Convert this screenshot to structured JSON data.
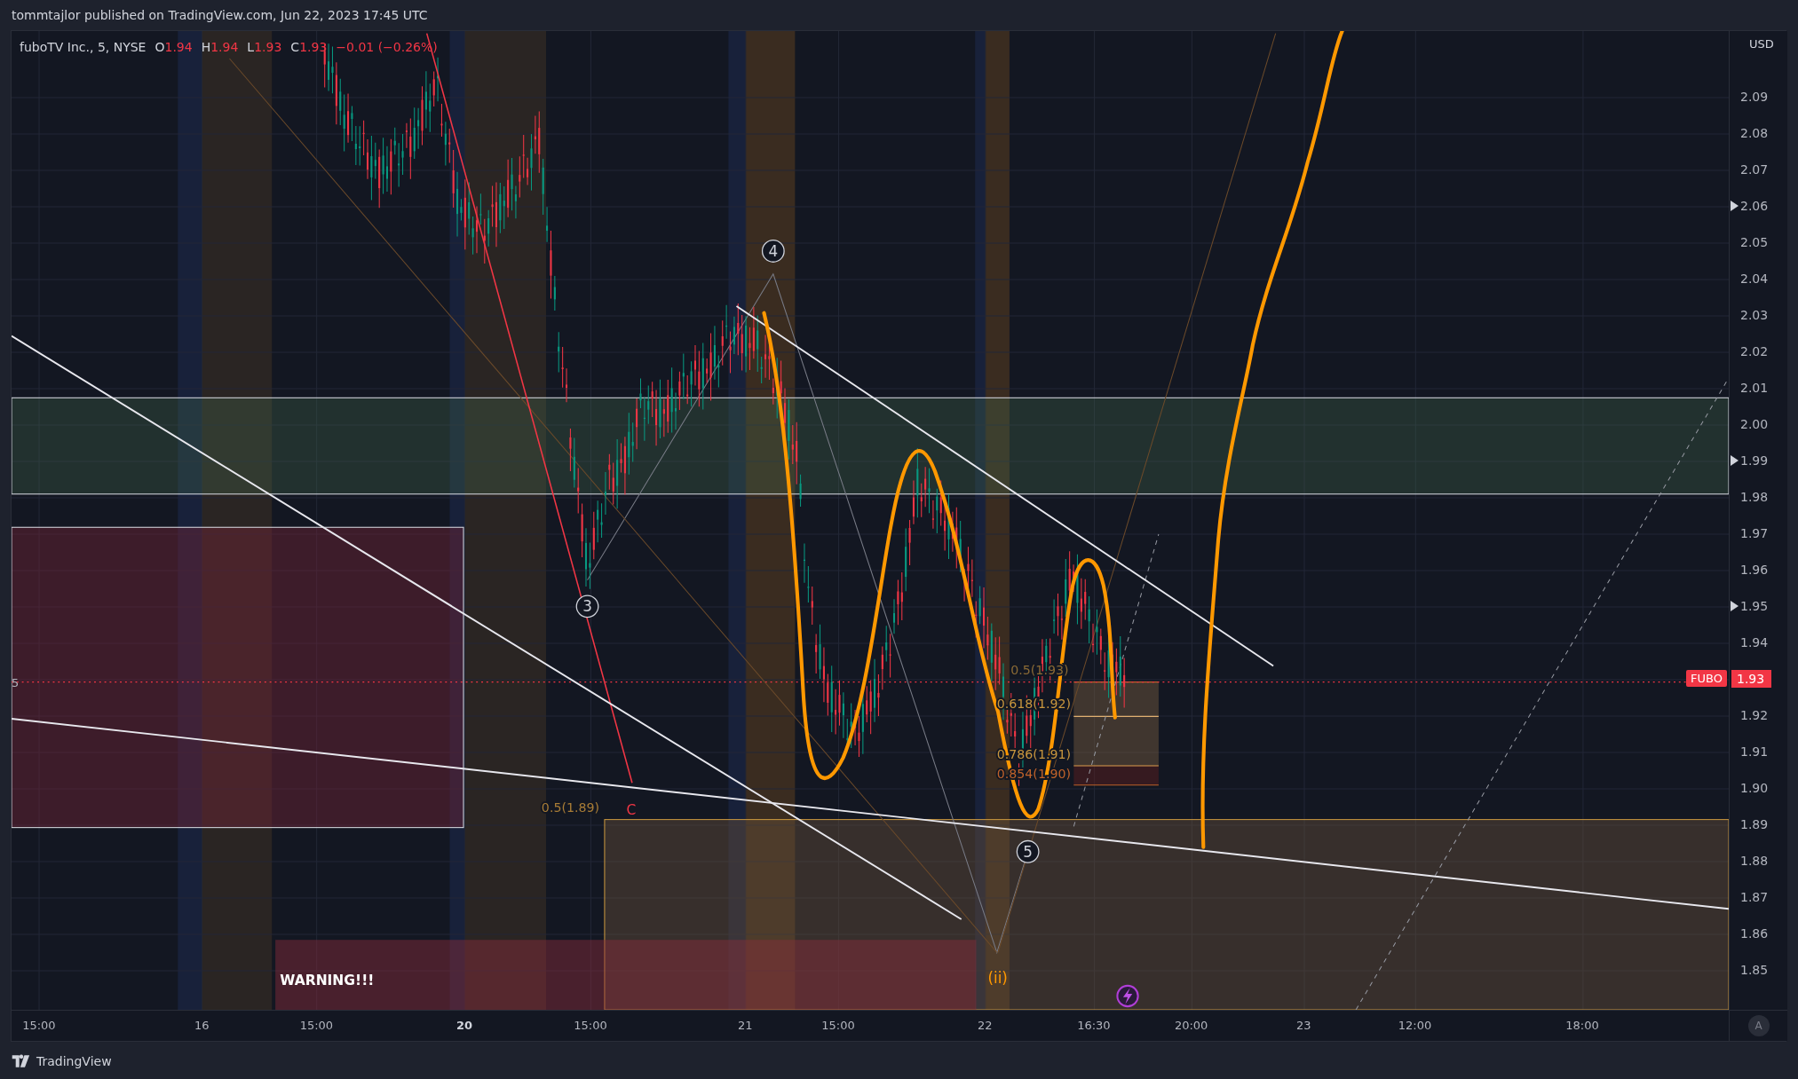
{
  "header": {
    "text": "tommtajlor published on TradingView.com, Jun 22, 2023 17:45 UTC"
  },
  "legend": {
    "symbol": "fuboTV Inc., 5, NYSE",
    "values": [
      {
        "label": "O",
        "value": "1.94"
      },
      {
        "label": "H",
        "value": "1.94"
      },
      {
        "label": "L",
        "value": "1.93"
      },
      {
        "label": "C",
        "value": "1.93"
      }
    ],
    "change": "−0.01 (−0.26%)"
  },
  "chart": {
    "price_line_label": "5",
    "wave_labels": [
      {
        "label": "3"
      },
      {
        "label": "4"
      },
      {
        "label": "5"
      }
    ],
    "fib_labels": [
      {
        "label": "0.5(1.93)",
        "color": "#8a6a35"
      },
      {
        "label": "0.618(1.92)",
        "color": "#c8963e"
      },
      {
        "label": "0.786(1.91)",
        "color": "#c8963e"
      },
      {
        "label": "0.854(1.90)",
        "color": "#c0622a"
      },
      {
        "label": "0.5(1.89)",
        "color": "#a87c36"
      }
    ],
    "corrective_label": "C",
    "subwave_label": "(ii)",
    "warning": "WARNING!!!"
  },
  "price_axis": {
    "currency": "USD",
    "ticks": [
      {
        "kind": "price",
        "label": "2.09",
        "marked": false
      },
      {
        "kind": "price",
        "label": "2.08",
        "marked": false
      },
      {
        "kind": "price",
        "label": "2.07",
        "marked": false
      },
      {
        "kind": "price",
        "label": "2.06",
        "marked": true
      },
      {
        "kind": "price",
        "label": "2.05",
        "marked": false
      },
      {
        "kind": "price",
        "label": "2.04",
        "marked": false
      },
      {
        "kind": "price",
        "label": "2.03",
        "marked": false
      },
      {
        "kind": "price",
        "label": "2.02",
        "marked": false
      },
      {
        "kind": "price",
        "label": "2.01",
        "marked": false
      },
      {
        "kind": "price",
        "label": "2.00",
        "marked": false
      },
      {
        "kind": "price",
        "label": "1.99",
        "marked": true
      },
      {
        "kind": "price",
        "label": "1.98",
        "marked": false
      },
      {
        "kind": "price",
        "label": "1.97",
        "marked": false
      },
      {
        "kind": "price",
        "label": "1.96",
        "marked": false
      },
      {
        "kind": "price",
        "label": "1.95",
        "marked": true
      },
      {
        "kind": "price",
        "label": "1.94",
        "marked": false
      },
      {
        "kind": "last",
        "symbol": "FUBO",
        "label": "1.93"
      },
      {
        "kind": "price",
        "label": "1.92",
        "marked": false
      },
      {
        "kind": "price",
        "label": "1.91",
        "marked": false
      },
      {
        "kind": "price",
        "label": "1.90",
        "marked": false
      },
      {
        "kind": "price",
        "label": "1.89",
        "marked": false
      },
      {
        "kind": "price",
        "label": "1.88",
        "marked": false
      },
      {
        "kind": "price",
        "label": "1.87",
        "marked": false
      },
      {
        "kind": "price",
        "label": "1.86",
        "marked": false
      },
      {
        "kind": "price",
        "label": "1.85",
        "marked": false
      }
    ]
  },
  "time_axis": {
    "labels": [
      {
        "label": "15:00",
        "bold": false
      },
      {
        "label": "16",
        "bold": false
      },
      {
        "label": "15:00",
        "bold": false
      },
      {
        "label": "20",
        "bold": true
      },
      {
        "label": "15:00",
        "bold": false
      },
      {
        "label": "21",
        "bold": false
      },
      {
        "label": "15:00",
        "bold": false
      },
      {
        "label": "22",
        "bold": false
      },
      {
        "label": "16:30",
        "bold": false
      },
      {
        "label": "20:00",
        "bold": false
      },
      {
        "label": "23",
        "bold": false
      },
      {
        "label": "12:00",
        "bold": false
      },
      {
        "label": "18:00",
        "bold": false
      }
    ],
    "auto_button": "A"
  },
  "footer": {
    "brand": "TradingView"
  }
}
